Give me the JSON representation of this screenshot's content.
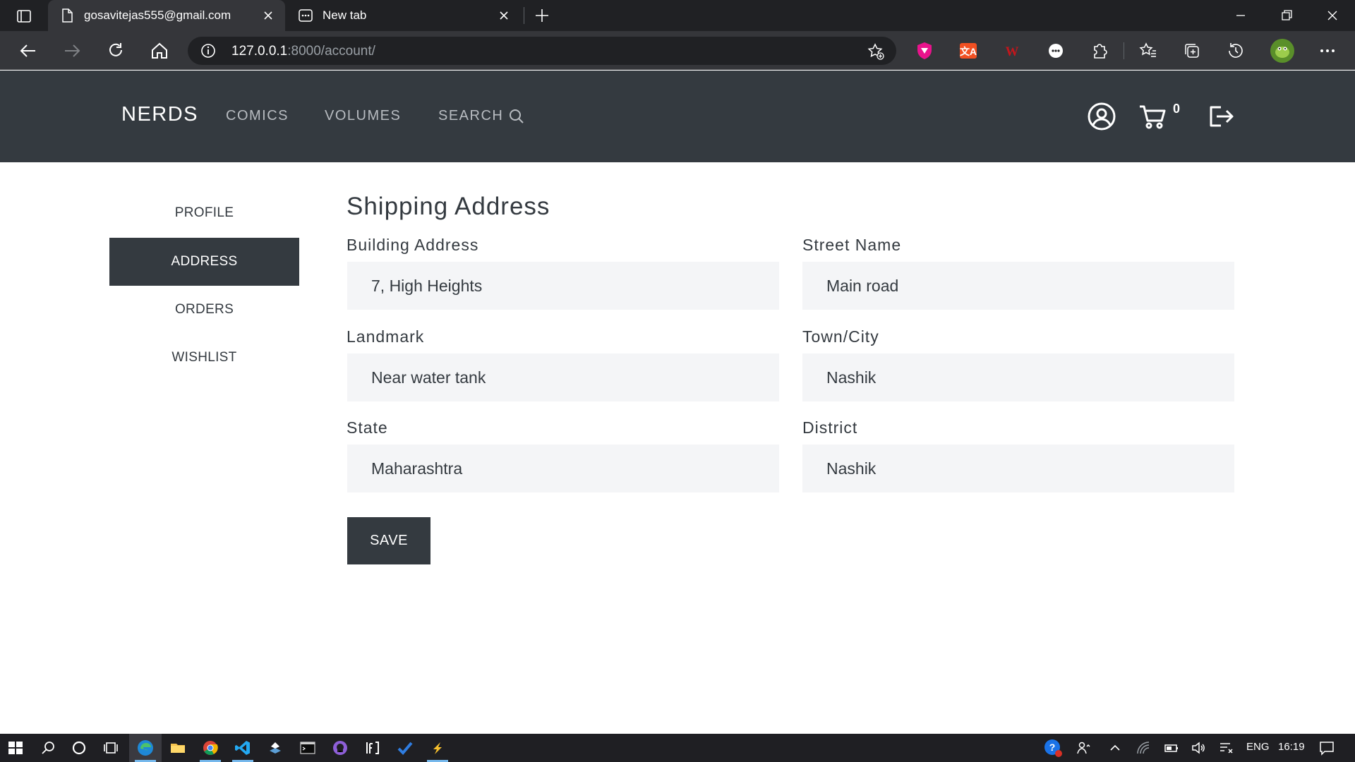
{
  "browser": {
    "tabs": [
      {
        "title": "gosavitejas555@gmail.com",
        "icon": "page-icon",
        "active": true
      },
      {
        "title": "New tab",
        "icon": "newtab-icon",
        "active": false
      }
    ],
    "url_host": "127.0.0.1",
    "url_rest": ":8000/account/"
  },
  "site": {
    "brand": "NERDS",
    "nav": {
      "comics": "COMICS",
      "volumes": "VOLUMES",
      "search": "SEARCH"
    },
    "cart_count": "0"
  },
  "sidebar": {
    "items": [
      {
        "label": "PROFILE",
        "active": false
      },
      {
        "label": "ADDRESS",
        "active": true
      },
      {
        "label": "ORDERS",
        "active": false
      },
      {
        "label": "WISHLIST",
        "active": false
      }
    ]
  },
  "form": {
    "title": "Shipping Address",
    "fields": [
      {
        "label": "Building Address",
        "value": "7, High Heights"
      },
      {
        "label": "Street Name",
        "value": "Main road"
      },
      {
        "label": "Landmark",
        "value": "Near water tank"
      },
      {
        "label": "Town/City",
        "value": "Nashik"
      },
      {
        "label": "State",
        "value": "Maharashtra"
      },
      {
        "label": "District",
        "value": "Nashik"
      }
    ],
    "save_label": "SAVE"
  },
  "taskbar": {
    "language": "ENG",
    "time": "16:19"
  },
  "colors": {
    "header_bg": "#343a40",
    "input_bg": "#f4f5f7",
    "browser_bg": "#202124"
  }
}
